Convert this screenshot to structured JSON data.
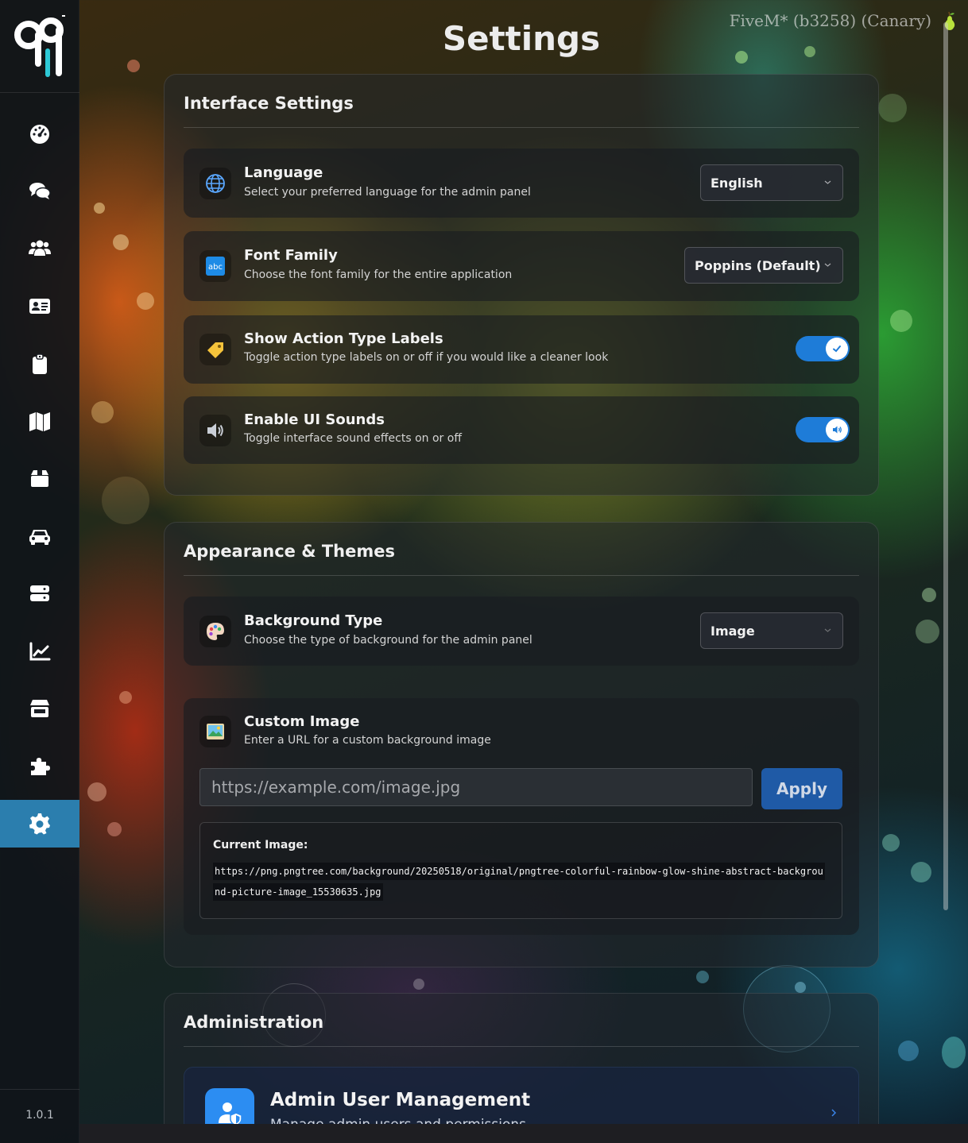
{
  "app": {
    "page_title": "Settings",
    "build_info": "FiveM* (b3258) (Canary)",
    "version": "1.0.1"
  },
  "sidebar": {
    "items": [
      {
        "icon": "dashboard-icon"
      },
      {
        "icon": "chat-icon"
      },
      {
        "icon": "users-icon"
      },
      {
        "icon": "id-card-icon"
      },
      {
        "icon": "clipboard-icon"
      },
      {
        "icon": "map-icon"
      },
      {
        "icon": "box-icon"
      },
      {
        "icon": "car-icon"
      },
      {
        "icon": "server-icon"
      },
      {
        "icon": "chart-line-icon"
      },
      {
        "icon": "store-icon"
      },
      {
        "icon": "puzzle-icon"
      },
      {
        "icon": "gear-icon",
        "active": true
      }
    ]
  },
  "interface": {
    "title": "Interface Settings",
    "language": {
      "title": "Language",
      "desc": "Select your preferred language for the admin panel",
      "value": "English"
    },
    "font": {
      "title": "Font Family",
      "desc": "Choose the font family for the entire application",
      "value": "Poppins (Default)"
    },
    "action_labels": {
      "title": "Show Action Type Labels",
      "desc": "Toggle action type labels on or off if you would like a cleaner look",
      "enabled": true
    },
    "ui_sounds": {
      "title": "Enable UI Sounds",
      "desc": "Toggle interface sound effects on or off",
      "enabled": true
    }
  },
  "appearance": {
    "title": "Appearance & Themes",
    "background_type": {
      "title": "Background Type",
      "desc": "Choose the type of background for the admin panel",
      "value": "Image"
    },
    "custom_image": {
      "title": "Custom Image",
      "desc": "Enter a URL for a custom background image",
      "placeholder": "https://example.com/image.jpg",
      "apply_label": "Apply",
      "current_label": "Current Image:",
      "current_url": "https://png.pngtree.com/background/20250518/original/pngtree-colorful-rainbow-glow-shine-abstract-background-picture-image_15530635.jpg"
    }
  },
  "administration": {
    "title": "Administration",
    "user_management": {
      "title": "Admin User Management",
      "desc": "Manage admin users and permissions"
    }
  },
  "colors": {
    "accent": "#2b7eae",
    "toggle_on": "#1e7cd8",
    "apply_button": "#1f5aa6",
    "admin_icon": "#2c8df2"
  }
}
